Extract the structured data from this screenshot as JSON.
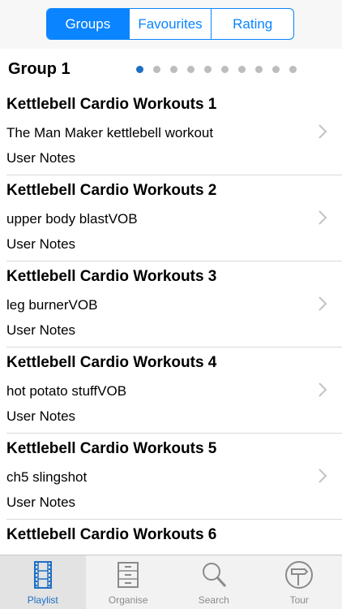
{
  "segmented_control": {
    "tabs": [
      {
        "label": "Groups",
        "selected": true
      },
      {
        "label": "Favourites",
        "selected": false
      },
      {
        "label": "Rating",
        "selected": false
      }
    ]
  },
  "group": {
    "title": "Group 1",
    "page_indicator": {
      "current": 1,
      "total": 10
    }
  },
  "items": [
    {
      "title": "Kettlebell Cardio Workouts 1",
      "subtitle": "The Man Maker kettlebell workout",
      "notes": "User Notes"
    },
    {
      "title": "Kettlebell Cardio Workouts 2",
      "subtitle": "upper body blastVOB",
      "notes": "User Notes"
    },
    {
      "title": "Kettlebell Cardio Workouts 3",
      "subtitle": "leg burnerVOB",
      "notes": "User Notes"
    },
    {
      "title": "Kettlebell Cardio Workouts 4",
      "subtitle": "hot potato stuffVOB",
      "notes": "User Notes"
    },
    {
      "title": "Kettlebell Cardio Workouts 5",
      "subtitle": "ch5 slingshot",
      "notes": "User Notes"
    },
    {
      "title": "Kettlebell Cardio Workouts 6",
      "subtitle": "",
      "notes": ""
    }
  ],
  "tabbar": {
    "tabs": [
      {
        "label": "Playlist",
        "icon": "film-strip-icon",
        "active": true
      },
      {
        "label": "Organise",
        "icon": "cabinet-icon",
        "active": false
      },
      {
        "label": "Search",
        "icon": "magnifier-icon",
        "active": false
      },
      {
        "label": "Tour",
        "icon": "signpost-icon",
        "active": false
      }
    ]
  },
  "colors": {
    "accent": "#0a84ff",
    "active_tab": "#1d6fc4",
    "inactive_dot": "#bdbdbd"
  }
}
